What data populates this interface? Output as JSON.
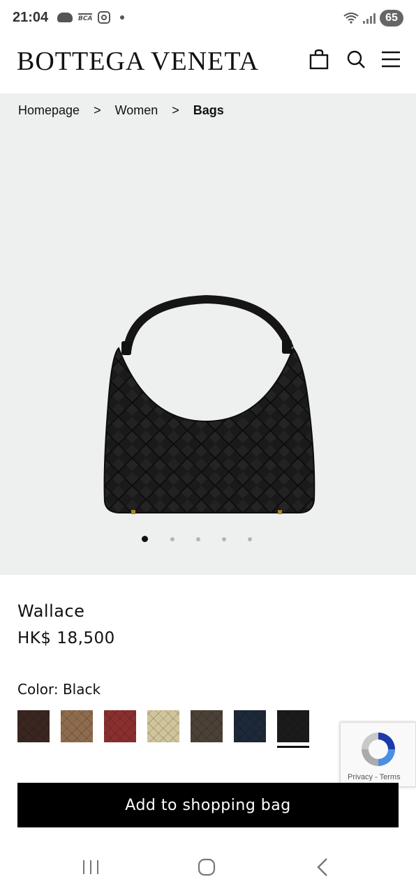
{
  "status_bar": {
    "time": "21:04",
    "battery": "65",
    "icons": [
      "cloud-icon",
      "bca-icon",
      "instagram-icon",
      "notification-dot-icon",
      "wifi-icon",
      "signal-icon",
      "battery-icon"
    ]
  },
  "header": {
    "brand": "BOTTEGA VENETA",
    "icons": [
      "shopping-bag-icon",
      "search-icon",
      "menu-icon"
    ]
  },
  "breadcrumb": {
    "items": [
      "Homepage",
      "Women",
      "Bags"
    ],
    "separator": ">"
  },
  "gallery": {
    "image_count": 5,
    "active_index": 0,
    "background": "#eef0ef"
  },
  "product": {
    "name": "Wallace",
    "price": "HK$ 18,500",
    "color_label": "Color: Black",
    "swatches": [
      {
        "name": "dark-brown",
        "color": "#3a2620"
      },
      {
        "name": "tan",
        "color": "#8f6b4d"
      },
      {
        "name": "red",
        "color": "#8a2f2f"
      },
      {
        "name": "beige",
        "color": "#cfc49a"
      },
      {
        "name": "olive-brown",
        "color": "#4b4136"
      },
      {
        "name": "navy",
        "color": "#1d2838"
      },
      {
        "name": "black",
        "color": "#1b1b1b"
      }
    ],
    "selected_swatch": 6
  },
  "recaptcha": {
    "links": "Privacy - Terms"
  },
  "actions": {
    "add_to_bag": "Add to shopping bag"
  },
  "nav_bar": {
    "icons": [
      "recent-apps-icon",
      "home-icon",
      "back-icon"
    ]
  }
}
